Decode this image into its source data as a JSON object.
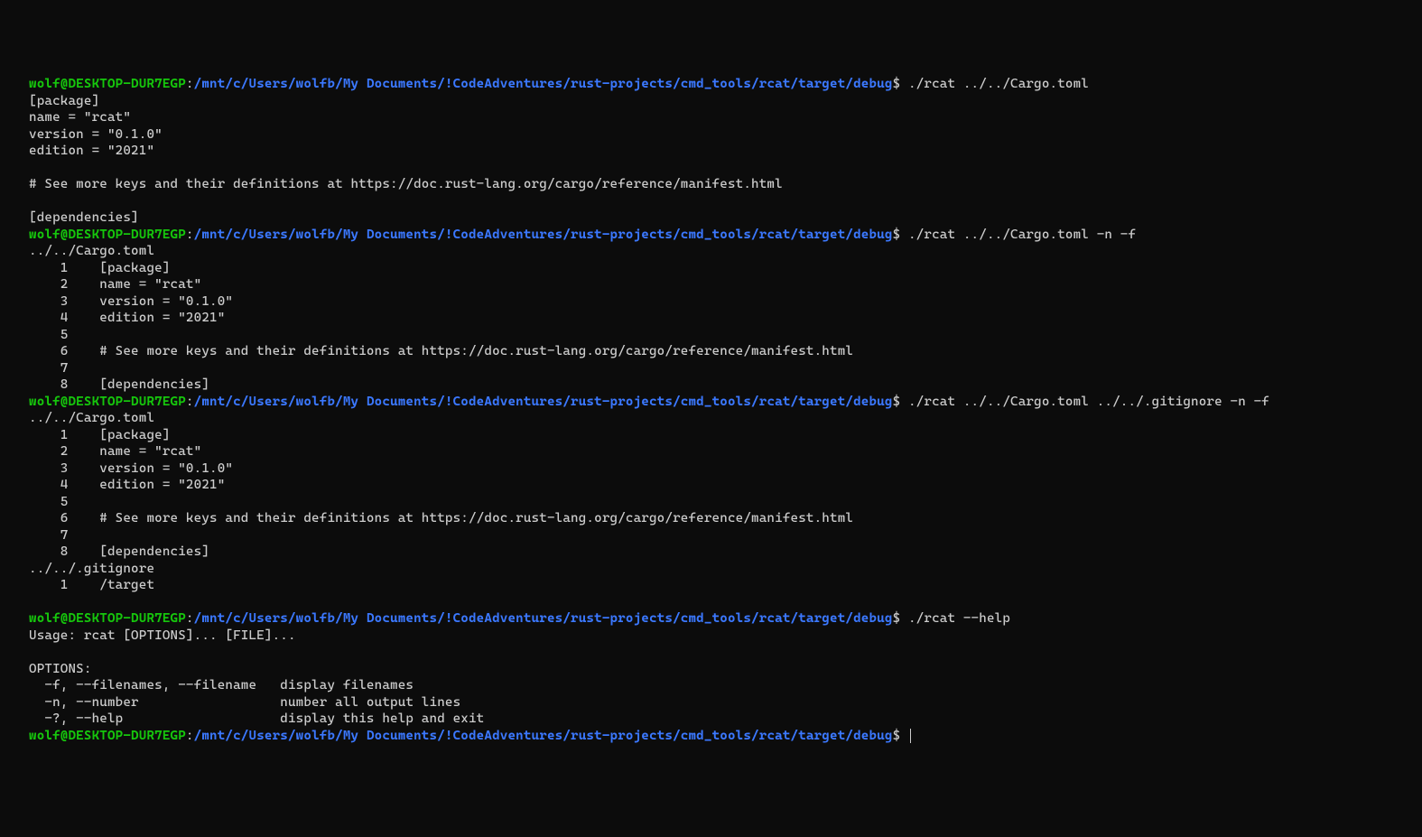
{
  "prompt": {
    "user_host": "wolf@DESKTOP-DUR7EGP",
    "colon": ":",
    "path": "/mnt/c/Users/wolfb/My Documents/!CodeAdventures/rust-projects/cmd_tools/rcat/target/debug",
    "dollar": "$"
  },
  "cmd1": "./rcat ../../Cargo.toml",
  "out1": [
    "[package]",
    "name = \"rcat\"",
    "version = \"0.1.0\"",
    "edition = \"2021\"",
    "",
    "# See more keys and their definitions at https://doc.rust-lang.org/cargo/reference/manifest.html",
    "",
    "[dependencies]"
  ],
  "cmd2": "./rcat ../../Cargo.toml -n -f",
  "out2": [
    "../../Cargo.toml",
    "    1    [package]",
    "    2    name = \"rcat\"",
    "    3    version = \"0.1.0\"",
    "    4    edition = \"2021\"",
    "    5",
    "    6    # See more keys and their definitions at https://doc.rust-lang.org/cargo/reference/manifest.html",
    "    7",
    "    8    [dependencies]"
  ],
  "cmd3": "./rcat ../../Cargo.toml ../../.gitignore -n -f",
  "out3": [
    "../../Cargo.toml",
    "    1    [package]",
    "    2    name = \"rcat\"",
    "    3    version = \"0.1.0\"",
    "    4    edition = \"2021\"",
    "    5",
    "    6    # See more keys and their definitions at https://doc.rust-lang.org/cargo/reference/manifest.html",
    "    7",
    "    8    [dependencies]",
    "../../.gitignore",
    "    1    /target",
    ""
  ],
  "cmd4": "./rcat --help",
  "out4": [
    "Usage: rcat [OPTIONS]... [FILE]...",
    "",
    "OPTIONS:",
    "  -f, --filenames, --filename   display filenames",
    "  -n, --number                  number all output lines",
    "  -?, --help                    display this help and exit"
  ]
}
